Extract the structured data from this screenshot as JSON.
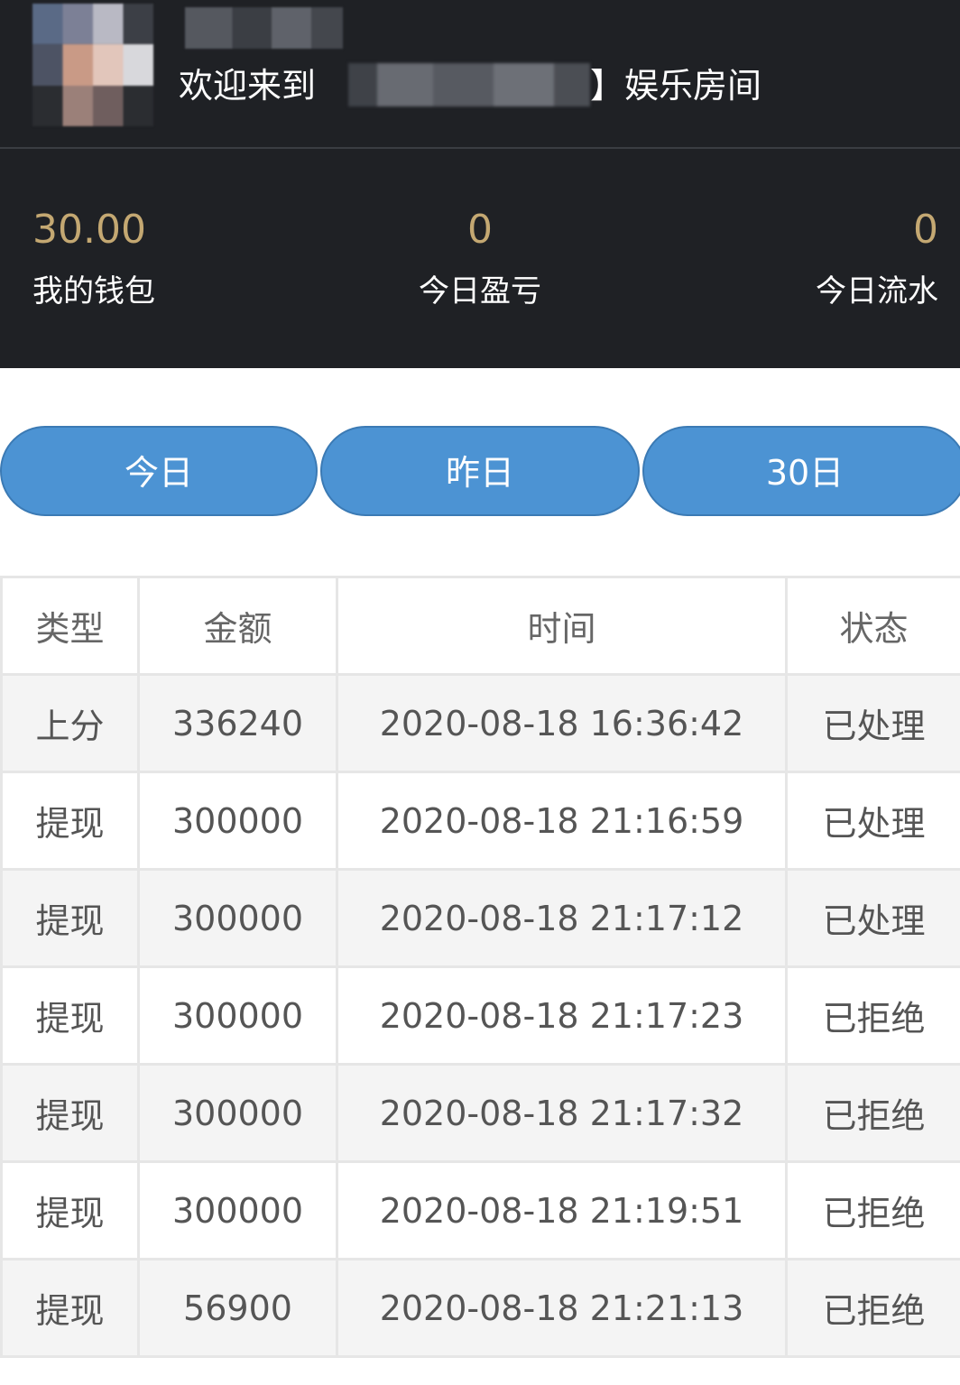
{
  "header": {
    "welcome_prefix": "欢迎来到",
    "welcome_suffix": "】娱乐房间",
    "stats": {
      "wallet_value": "30.00",
      "wallet_label": "我的钱包",
      "profit_value": "0",
      "profit_label": "今日盈亏",
      "turnover_value": "0",
      "turnover_label": "今日流水"
    }
  },
  "tabs": [
    {
      "label": "今日"
    },
    {
      "label": "昨日"
    },
    {
      "label": "30日"
    }
  ],
  "table": {
    "headers": [
      "类型",
      "金额",
      "时间",
      "状态"
    ],
    "rows": [
      {
        "type": "上分",
        "amount": "336240",
        "time": "2020-08-18 16:36:42",
        "status": "已处理"
      },
      {
        "type": "提现",
        "amount": "300000",
        "time": "2020-08-18 21:16:59",
        "status": "已处理"
      },
      {
        "type": "提现",
        "amount": "300000",
        "time": "2020-08-18 21:17:12",
        "status": "已处理"
      },
      {
        "type": "提现",
        "amount": "300000",
        "time": "2020-08-18 21:17:23",
        "status": "已拒绝"
      },
      {
        "type": "提现",
        "amount": "300000",
        "time": "2020-08-18 21:17:32",
        "status": "已拒绝"
      },
      {
        "type": "提现",
        "amount": "300000",
        "time": "2020-08-18 21:19:51",
        "status": "已拒绝"
      },
      {
        "type": "提现",
        "amount": "56900",
        "time": "2020-08-18 21:21:13",
        "status": "已拒绝"
      }
    ]
  },
  "colors": {
    "header_bg": "#1f2125",
    "stat_value": "#c4a872",
    "tab_bg": "#4c93d3"
  }
}
